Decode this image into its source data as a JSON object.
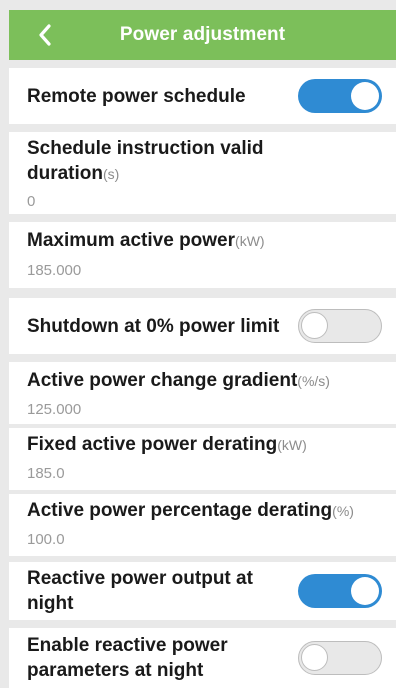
{
  "header": {
    "title": "Power adjustment",
    "back_icon": "chevron-left-icon",
    "background": "#7cbf5a"
  },
  "items": [
    {
      "label": "Remote power schedule",
      "toggle": true
    },
    {
      "label": "Schedule instruction valid duration",
      "unit": "(s)",
      "value": "0"
    },
    {
      "label": "Maximum active power",
      "unit": "(kW)",
      "value": "185.000"
    },
    {
      "label": "Shutdown at 0% power limit",
      "toggle": false
    },
    {
      "label": "Active power change gradient",
      "unit": "(%/s)",
      "value": "125.000"
    },
    {
      "label": "Fixed active power derating",
      "unit": "(kW)",
      "value": "185.0"
    },
    {
      "label": "Active power percentage derating",
      "unit": "(%)",
      "value": "100.0"
    },
    {
      "label": "Reactive power output at night",
      "toggle": true
    },
    {
      "label": "Enable reactive power parameters at night",
      "toggle": false
    }
  ],
  "colors": {
    "toggle_on": "#2f8bd3",
    "toggle_off": "#e8e8e8",
    "page_background": "#e9e9e9"
  }
}
